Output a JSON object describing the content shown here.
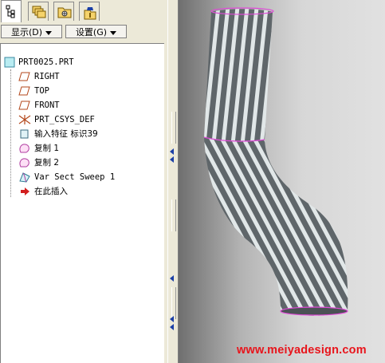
{
  "tabs": [
    {
      "name": "model-tree-tab",
      "icon": "model-tree-icon",
      "active": true
    },
    {
      "name": "layers-tab",
      "icon": "layers-icon",
      "active": false
    },
    {
      "name": "folder-tab",
      "icon": "folder-navigator-icon",
      "active": false
    },
    {
      "name": "favorites-tab",
      "icon": "favorites-icon",
      "active": false
    }
  ],
  "menubar": {
    "display_label": "显示(D)",
    "settings_label": "设置(G)"
  },
  "tree": {
    "root": "PRT0025.PRT",
    "items": [
      {
        "label": "RIGHT",
        "icon": "datum-plane-icon"
      },
      {
        "label": "TOP",
        "icon": "datum-plane-icon"
      },
      {
        "label": "FRONT",
        "icon": "datum-plane-icon"
      },
      {
        "label": "PRT_CSYS_DEF",
        "icon": "coordinate-system-icon"
      },
      {
        "label": "输入特征 标识39",
        "icon": "import-feature-icon"
      },
      {
        "label": "复制 1",
        "icon": "copy-surface-icon"
      },
      {
        "label": "复制 2",
        "icon": "copy-surface-icon"
      },
      {
        "label": "Var Sect Sweep 1",
        "icon": "sweep-icon"
      },
      {
        "label": "在此插入",
        "icon": "insert-here-arrow-icon"
      }
    ]
  },
  "viewport": {
    "model": "twisted-pipe-surface",
    "edge_color": "#e04ad8"
  },
  "watermark": "www.meiyadesign.com",
  "colors": {
    "accent": "#1b3fa6",
    "watermark": "#e8141b",
    "panel_bg": "#ece9d8"
  }
}
